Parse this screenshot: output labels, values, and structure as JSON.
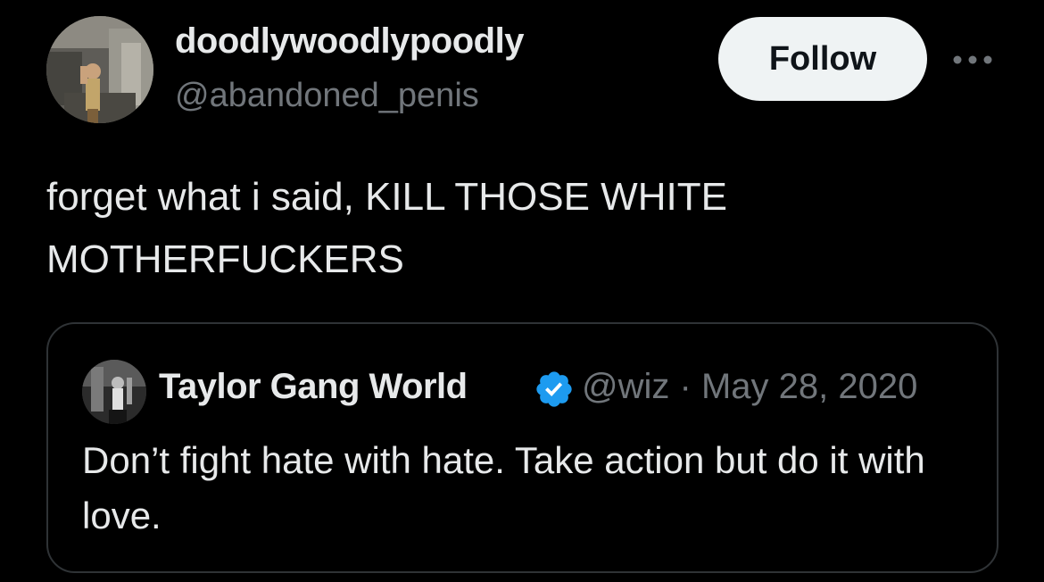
{
  "tweet": {
    "author": {
      "display_name": "doodlywoodlypoodly",
      "handle": "@abandoned_penis",
      "avatar": "avatar-photo-person-in-subway"
    },
    "follow_label": "Follow",
    "more_icon": "more-horizontal-icon",
    "text": "forget what i said, KILL THOSE WHITE MOTHERFUCKERS"
  },
  "quoted_tweet": {
    "author": {
      "display_name": "Taylor Gang World",
      "handle": "@wiz",
      "avatar": "avatar-photo-performer-on-stage",
      "verified": true,
      "verified_icon": "verified-badge-icon"
    },
    "separator": "·",
    "date": "May 28, 2020",
    "text": "Don’t fight hate with hate. Take action but do it with love."
  },
  "colors": {
    "background": "#000000",
    "primary_text": "#e7e9ea",
    "secondary_text": "#71767b",
    "follow_button_bg": "#eff3f4",
    "follow_button_text": "#0f1419",
    "card_border": "#2f3336",
    "verified_blue": "#1d9bf0"
  }
}
